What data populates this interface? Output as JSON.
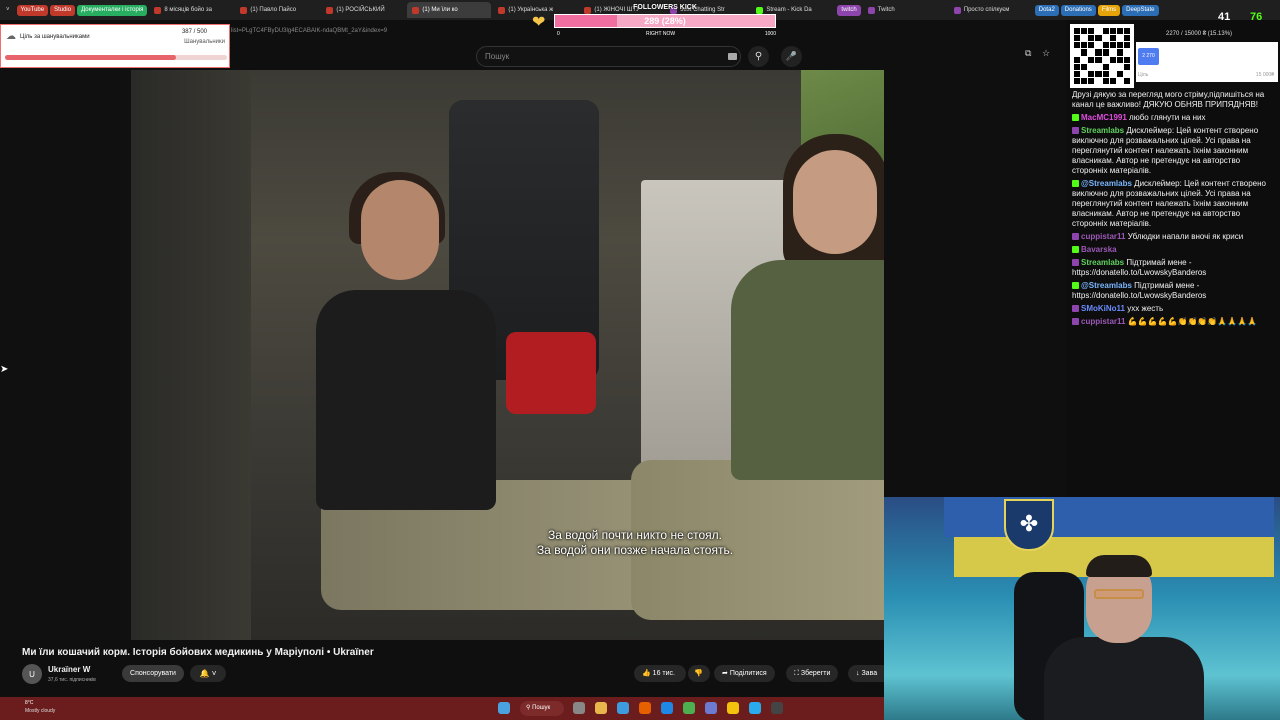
{
  "tabs": [
    {
      "label": "YouTube",
      "color": "#c0392b",
      "pill": true
    },
    {
      "label": "Studio",
      "color": "#c0392b",
      "pill": true
    },
    {
      "label": "Документалки і історія",
      "color": "#27ae60",
      "pill": true
    },
    {
      "label": "8 місяців бойо за",
      "color": "#c0392b"
    },
    {
      "label": "(1) Павло Пайсо",
      "color": "#c0392b"
    },
    {
      "label": "(1) РОСІЙСЬКИЙ",
      "color": "#c0392b"
    },
    {
      "label": "(1) Ми їли ко",
      "color": "#c0392b",
      "active": true
    },
    {
      "label": "(1) Українська ж",
      "color": "#c0392b"
    },
    {
      "label": "(1) ЖІНОЧІ ШТУ",
      "color": "#c0392b"
    },
    {
      "label": "Just Chatting Str",
      "color": "#8e44ad"
    },
    {
      "label": "Stream - Kick Da",
      "color": "#53fc18"
    },
    {
      "label": "twitch",
      "color": "#8e44ad",
      "pill": true
    },
    {
      "label": "Twitch",
      "color": "#8e44ad"
    },
    {
      "label": "Просто спілкуєм",
      "color": "#8e44ad"
    },
    {
      "label": "Dota2",
      "color": "#2c6eb5",
      "pill": true
    },
    {
      "label": "Donations",
      "color": "#2c6eb5",
      "pill": true
    },
    {
      "label": "Films",
      "color": "#e5a50a",
      "pill": true
    },
    {
      "label": "DeepState",
      "color": "#2c6eb5",
      "pill": true
    }
  ],
  "url_fragment": "list=PLgTC4FByDU3lg4ECABAIK-ndaQBMt_2aY&index=9",
  "search_placeholder": "Пошук",
  "followers_goal": {
    "title": "FOLLOWERS KICK",
    "value_text": "289 (28%)",
    "percent": 28,
    "min": "0",
    "mid": "RIGHT NOW",
    "max": "1000"
  },
  "supporters_goal": {
    "label": "Ціль за шанувальниками",
    "count": "387 / 500",
    "sub": "Шанувальники",
    "percent": 77
  },
  "subtitles": [
    "За водой почти никто не стоял.",
    "За водой они позже начала стоять."
  ],
  "video": {
    "title": "Ми їли кошачий корм. Історія бойових медикинь у Маріуполі • Ukraїner",
    "channel": "Ukraїner W",
    "subscribers": "37,6 тис. підписників",
    "sponsor_label": "Спонсорувати",
    "likes": "16 тис.",
    "share_label": "Поділитися",
    "save_label": "Зберегти",
    "download_label": "Зава"
  },
  "taskbar": {
    "temp": "8°C",
    "weather": "Mostly cloudy",
    "search_label": "Пошук"
  },
  "donation_goal": {
    "text": "2270 / 15000 ₴ (15.13%)",
    "current": "2 270",
    "label": "Ціль",
    "max": "15 000₴",
    "percent": 15.13
  },
  "counts": {
    "viewers": "41",
    "kick": "76"
  },
  "chat": [
    {
      "user": "",
      "text": "Друзі дякую за перегляд мого стріму,підпишіться на канал це важливо! ДЯКУЮ ОБНЯВ ПРИПЯДНЯВ!",
      "color": "#f1f1f1",
      "badge": ""
    },
    {
      "user": "MacMC1991",
      "text": "любо глянути на них",
      "color": "#e14de0",
      "badge": "#53fc18"
    },
    {
      "user": "Streamlabs",
      "text": "Дисклеймер: Цей контент створено виключно для розважальних цілей. Усі права на переглянутий контент належать їхнім законним власникам. Автор не претендує на авторство сторонніх матеріалів.",
      "color": "#5fd35f",
      "badge": "#8e44ad"
    },
    {
      "user": "@Streamlabs",
      "text": "Дисклеймер: Цей контент створено виключно для розважальних цілей. Усі права на переглянутий контент належать їхнім законним власникам. Автор не претендує на авторство сторонніх матеріалів.",
      "color": "#7ab6ff",
      "badge": "#53fc18"
    },
    {
      "user": "cuppistar11",
      "text": "Ублюдки напали вночі як криси",
      "color": "#9b59b6",
      "badge": "#8e44ad"
    },
    {
      "user": "Bavarska",
      "text": "",
      "color": "#9b59b6",
      "badge": "#53fc18"
    },
    {
      "user": "Streamlabs",
      "text": "Підтримай мене - https://donatello.to/LwowskyBanderos",
      "color": "#5fd35f",
      "badge": "#8e44ad"
    },
    {
      "user": "@Streamlabs",
      "text": "Підтримай мене - https://donatello.to/LwowskyBanderos",
      "color": "#7ab6ff",
      "badge": "#53fc18"
    },
    {
      "user": "SMoKiNo11",
      "text": "ухх жесть",
      "color": "#6a8cff",
      "badge": "#8e44ad"
    },
    {
      "user": "cuppistar11",
      "text": "💪💪💪💪💪👏👏👏👏🙏🙏🙏🙏",
      "color": "#9b59b6",
      "badge": "#8e44ad"
    }
  ]
}
